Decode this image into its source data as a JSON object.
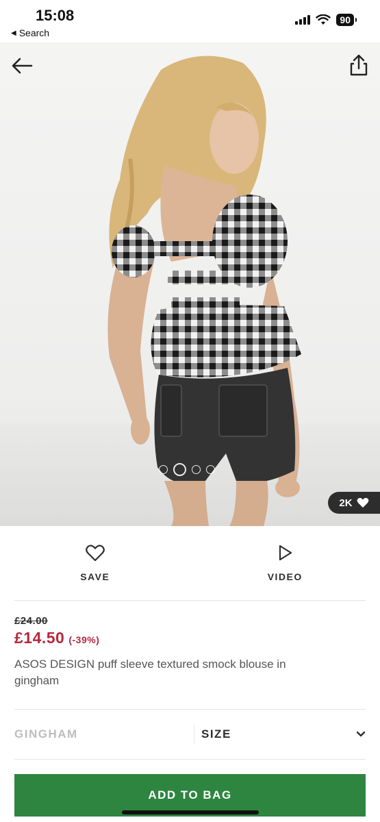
{
  "status_bar": {
    "time": "15:08",
    "back_app": "Search",
    "battery": "90"
  },
  "hero": {
    "likes": "2K",
    "carousel": {
      "total": 4,
      "active_index": 1
    }
  },
  "actions": {
    "save_label": "SAVE",
    "video_label": "VIDEO"
  },
  "product": {
    "was_price": "£24.00",
    "now_price": "£14.50",
    "discount": "(-39%)",
    "name": "ASOS DESIGN puff sleeve textured smock blouse in gingham"
  },
  "selectors": {
    "colour": "GINGHAM",
    "size_label": "SIZE"
  },
  "cta": {
    "add_to_bag": "ADD TO BAG"
  },
  "colors": {
    "sale_red": "#b5283e",
    "cta_green": "#2e8540",
    "text_dark": "#2d2d2d"
  },
  "icons": [
    "back-arrow-icon",
    "share-icon",
    "heart-icon",
    "play-icon",
    "chevron-down-icon"
  ]
}
